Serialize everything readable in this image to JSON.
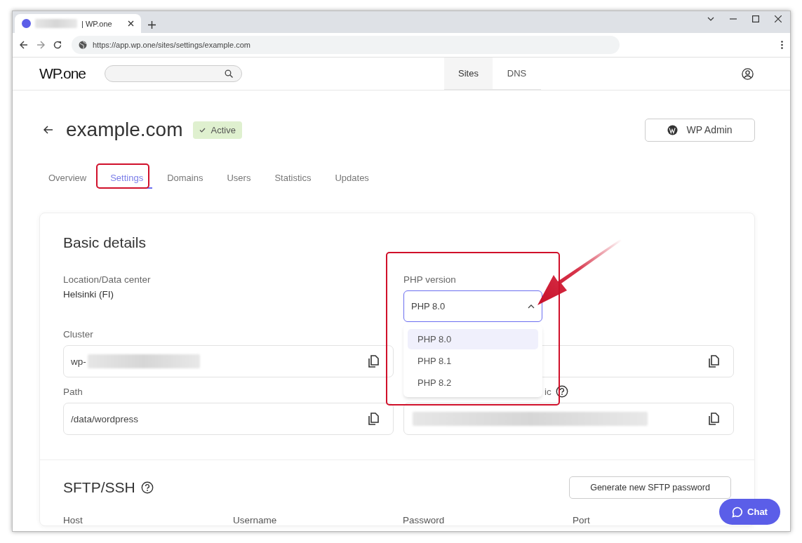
{
  "browser": {
    "tab": {
      "title": "| WP.one",
      "redacted": true
    },
    "url": "https://app.wp.one/sites/settings/example.com"
  },
  "header": {
    "logo": "WP.one",
    "nav_tabs": [
      {
        "label": "Sites",
        "selected": true
      },
      {
        "label": "DNS",
        "selected": false
      }
    ]
  },
  "site": {
    "title": "example.com",
    "status": "Active",
    "admin_button": "WP Admin"
  },
  "tabs": [
    {
      "label": "Overview",
      "selected": false
    },
    {
      "label": "Settings",
      "selected": true
    },
    {
      "label": "Domains",
      "selected": false
    },
    {
      "label": "Users",
      "selected": false
    },
    {
      "label": "Statistics",
      "selected": false
    },
    {
      "label": "Updates",
      "selected": false
    }
  ],
  "basic": {
    "heading": "Basic details",
    "location": {
      "label": "Location/Data center",
      "value": "Helsinki (FI)"
    },
    "php": {
      "label": "PHP version",
      "value": "PHP 8.0",
      "expanded": true,
      "options": [
        {
          "label": "PHP 8.0",
          "selected": true
        },
        {
          "label": "PHP 8.1",
          "selected": false
        },
        {
          "label": "PHP 8.2",
          "selected": false
        }
      ]
    },
    "fields": [
      {
        "label": "Cluster",
        "value": "wp-",
        "redacted": true,
        "copyable": true
      },
      {
        "copyable": true
      },
      {
        "label": "Path",
        "value": "/data/wordpress",
        "copyable": true
      },
      {
        "label": "ic",
        "redacted": true,
        "help": true,
        "copyable": true
      }
    ]
  },
  "sftp": {
    "heading": "SFTP/SSH",
    "help": true,
    "button": "Generate new SFTP password",
    "columns": [
      "Host",
      "Username",
      "Password",
      "Port"
    ]
  },
  "chat": {
    "label": "Chat"
  }
}
